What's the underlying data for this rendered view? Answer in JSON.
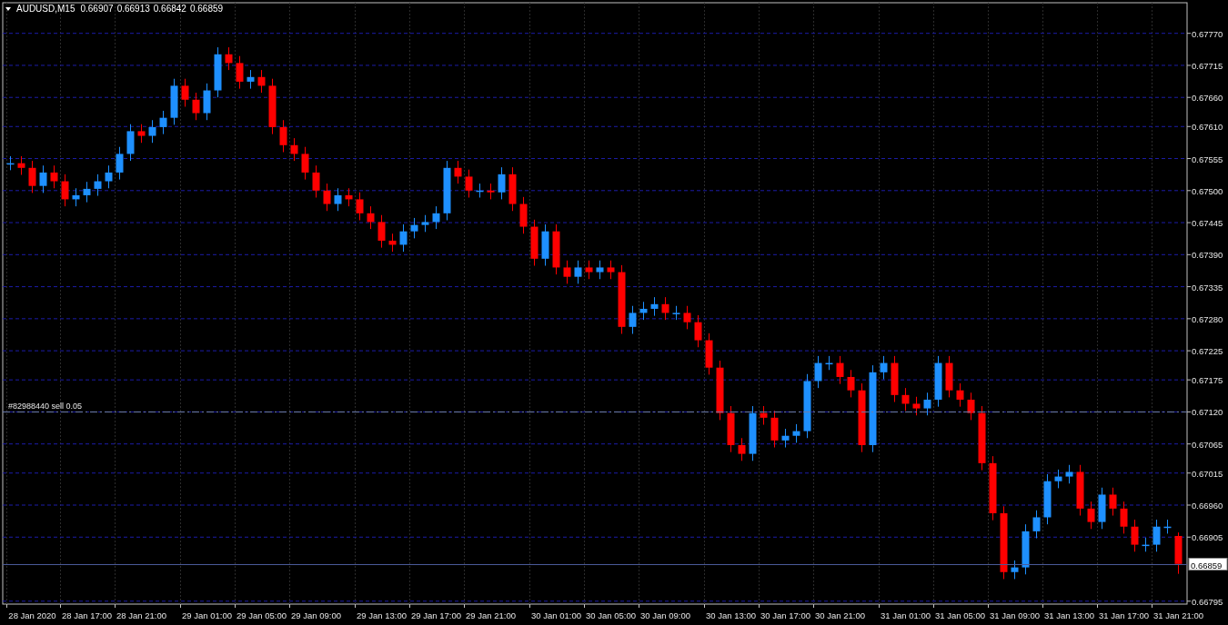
{
  "header": {
    "symbol": "AUDUSD,M15",
    "ohlc": [
      "0.66907",
      "0.66913",
      "0.66842",
      "0.66859"
    ]
  },
  "chart": {
    "chart_data": {
      "type": "candlestick",
      "grid": true,
      "ylim": [
        0.6679,
        0.67821
      ],
      "yticks": [
        {
          "value": 0.6777,
          "label": "0.67770"
        },
        {
          "value": 0.67715,
          "label": "0.67715"
        },
        {
          "value": 0.6766,
          "label": "0.67660"
        },
        {
          "value": 0.6761,
          "label": "0.67610"
        },
        {
          "value": 0.67555,
          "label": "0.67555"
        },
        {
          "value": 0.675,
          "label": "0.67500"
        },
        {
          "value": 0.67445,
          "label": "0.67445"
        },
        {
          "value": 0.6739,
          "label": "0.67390"
        },
        {
          "value": 0.67335,
          "label": "0.67335"
        },
        {
          "value": 0.6728,
          "label": "0.67280"
        },
        {
          "value": 0.67225,
          "label": "0.67225"
        },
        {
          "value": 0.67175,
          "label": "0.67175"
        },
        {
          "value": 0.6712,
          "label": "0.67120"
        },
        {
          "value": 0.67065,
          "label": "0.67065"
        },
        {
          "value": 0.67015,
          "label": "0.67015"
        },
        {
          "value": 0.6696,
          "label": "0.66960"
        },
        {
          "value": 0.66905,
          "label": "0.66905"
        },
        {
          "value": 0.66795,
          "label": "0.66795"
        }
      ],
      "categories": [
        null,
        null,
        "28 Jan 2020",
        null,
        null,
        null,
        null,
        "28 Jan 17:00",
        null,
        null,
        null,
        null,
        "28 Jan 21:00",
        null,
        null,
        null,
        null,
        null,
        "29 Jan 01:00",
        null,
        null,
        null,
        null,
        "29 Jan 05:00",
        null,
        null,
        null,
        null,
        "29 Jan 09:00",
        null,
        null,
        null,
        null,
        null,
        "29 Jan 13:00",
        null,
        null,
        null,
        null,
        "29 Jan 17:00",
        null,
        null,
        null,
        null,
        "29 Jan 21:00",
        null,
        null,
        null,
        null,
        null,
        "30 Jan 01:00",
        null,
        null,
        null,
        null,
        "30 Jan 05:00",
        null,
        null,
        null,
        null,
        "30 Jan 09:00",
        null,
        null,
        null,
        null,
        null,
        "30 Jan 13:00",
        null,
        null,
        null,
        null,
        "30 Jan 17:00",
        null,
        null,
        null,
        null,
        "30 Jan 21:00",
        null,
        null,
        null,
        null,
        null,
        "31 Jan 01:00",
        null,
        null,
        null,
        null,
        "31 Jan 05:00",
        null,
        null,
        null,
        null,
        "31 Jan 09:00",
        null,
        null,
        null,
        null,
        "31 Jan 13:00",
        null,
        null,
        null,
        null,
        "31 Jan 17:00",
        null,
        null,
        null,
        null,
        "31 Jan 21:00"
      ],
      "ohlc": [
        [
          0.67547,
          0.67559,
          0.67535,
          0.67547
        ],
        [
          0.67547,
          0.67559,
          0.67527,
          0.67539
        ],
        [
          0.67539,
          0.67551,
          0.67496,
          0.67508
        ],
        [
          0.67508,
          0.67543,
          0.67496,
          0.67531
        ],
        [
          0.67531,
          0.67543,
          0.67504,
          0.67516
        ],
        [
          0.67516,
          0.67528,
          0.67473,
          0.67485
        ],
        [
          0.67485,
          0.67504,
          0.67473,
          0.67492
        ],
        [
          0.67492,
          0.67515,
          0.6748,
          0.67503
        ],
        [
          0.67503,
          0.67528,
          0.67491,
          0.67516
        ],
        [
          0.67516,
          0.67543,
          0.67504,
          0.67531
        ],
        [
          0.67531,
          0.67575,
          0.67519,
          0.67563
        ],
        [
          0.67563,
          0.67614,
          0.67551,
          0.67602
        ],
        [
          0.67602,
          0.67614,
          0.67582,
          0.67594
        ],
        [
          0.67594,
          0.67621,
          0.67582,
          0.67609
        ],
        [
          0.67609,
          0.67637,
          0.67597,
          0.67625
        ],
        [
          0.67625,
          0.67692,
          0.67613,
          0.6768
        ],
        [
          0.6768,
          0.67692,
          0.67644,
          0.67656
        ],
        [
          0.67656,
          0.67668,
          0.67621,
          0.67633
        ],
        [
          0.67633,
          0.67684,
          0.67621,
          0.67672
        ],
        [
          0.67672,
          0.67746,
          0.6766,
          0.67734
        ],
        [
          0.67734,
          0.67746,
          0.67707,
          0.67719
        ],
        [
          0.67719,
          0.67731,
          0.67675,
          0.67687
        ],
        [
          0.67687,
          0.67707,
          0.67675,
          0.67695
        ],
        [
          0.67695,
          0.67707,
          0.67668,
          0.6768
        ],
        [
          0.6768,
          0.67692,
          0.67597,
          0.67609
        ],
        [
          0.67609,
          0.67621,
          0.67566,
          0.67578
        ],
        [
          0.67578,
          0.6759,
          0.67551,
          0.67563
        ],
        [
          0.67563,
          0.67575,
          0.67519,
          0.67531
        ],
        [
          0.67531,
          0.67543,
          0.67488,
          0.675
        ],
        [
          0.675,
          0.67512,
          0.67465,
          0.67477
        ],
        [
          0.67477,
          0.67504,
          0.67465,
          0.67492
        ],
        [
          0.67492,
          0.67504,
          0.67473,
          0.67485
        ],
        [
          0.67485,
          0.67497,
          0.67449,
          0.67461
        ],
        [
          0.67461,
          0.67473,
          0.67434,
          0.67446
        ],
        [
          0.67446,
          0.67458,
          0.67402,
          0.67414
        ],
        [
          0.67414,
          0.67426,
          0.67395,
          0.67407
        ],
        [
          0.67407,
          0.67442,
          0.67395,
          0.6743
        ],
        [
          0.6743,
          0.67453,
          0.67418,
          0.67441
        ],
        [
          0.67441,
          0.67458,
          0.67429,
          0.67446
        ],
        [
          0.67446,
          0.67473,
          0.67434,
          0.67461
        ],
        [
          0.67461,
          0.67551,
          0.67449,
          0.67539
        ],
        [
          0.67539,
          0.67551,
          0.67512,
          0.67524
        ],
        [
          0.67524,
          0.67536,
          0.67488,
          0.675
        ],
        [
          0.675,
          0.67512,
          0.67488,
          0.675
        ],
        [
          0.675,
          0.67512,
          0.67485,
          0.67497
        ],
        [
          0.67497,
          0.6754,
          0.67485,
          0.67528
        ],
        [
          0.67528,
          0.6754,
          0.67465,
          0.67477
        ],
        [
          0.67477,
          0.67489,
          0.67426,
          0.67438
        ],
        [
          0.67438,
          0.6745,
          0.67371,
          0.67383
        ],
        [
          0.67383,
          0.67442,
          0.67371,
          0.6743
        ],
        [
          0.6743,
          0.67442,
          0.67356,
          0.67368
        ],
        [
          0.67368,
          0.6738,
          0.6734,
          0.67352
        ],
        [
          0.67352,
          0.6738,
          0.6734,
          0.67368
        ],
        [
          0.67368,
          0.6738,
          0.67348,
          0.6736
        ],
        [
          0.6736,
          0.6738,
          0.67348,
          0.67368
        ],
        [
          0.67368,
          0.6738,
          0.67348,
          0.6736
        ],
        [
          0.6736,
          0.67372,
          0.67254,
          0.67266
        ],
        [
          0.67266,
          0.67302,
          0.67254,
          0.6729
        ],
        [
          0.6729,
          0.67309,
          0.67278,
          0.67297
        ],
        [
          0.67297,
          0.67317,
          0.67285,
          0.67305
        ],
        [
          0.67305,
          0.67317,
          0.67278,
          0.6729
        ],
        [
          0.6729,
          0.67302,
          0.67278,
          0.6729
        ],
        [
          0.6729,
          0.67302,
          0.67262,
          0.67274
        ],
        [
          0.67274,
          0.67286,
          0.67231,
          0.67243
        ],
        [
          0.67243,
          0.67255,
          0.67184,
          0.67196
        ],
        [
          0.67196,
          0.67208,
          0.67106,
          0.67118
        ],
        [
          0.67118,
          0.6713,
          0.67051,
          0.67063
        ],
        [
          0.67063,
          0.67075,
          0.67036,
          0.67048
        ],
        [
          0.67048,
          0.6713,
          0.67036,
          0.67118
        ],
        [
          0.67118,
          0.6713,
          0.67098,
          0.6711
        ],
        [
          0.6711,
          0.67122,
          0.67059,
          0.67071
        ],
        [
          0.67071,
          0.67091,
          0.67059,
          0.67079
        ],
        [
          0.67079,
          0.67099,
          0.67067,
          0.67087
        ],
        [
          0.67087,
          0.67185,
          0.67075,
          0.67173
        ],
        [
          0.67173,
          0.67216,
          0.67161,
          0.67204
        ],
        [
          0.67204,
          0.67216,
          0.67192,
          0.67204
        ],
        [
          0.67204,
          0.67216,
          0.67168,
          0.6718
        ],
        [
          0.6718,
          0.67192,
          0.67145,
          0.67157
        ],
        [
          0.67157,
          0.67169,
          0.67051,
          0.67063
        ],
        [
          0.67063,
          0.672,
          0.67051,
          0.67188
        ],
        [
          0.67188,
          0.67216,
          0.67176,
          0.67204
        ],
        [
          0.67204,
          0.67216,
          0.67137,
          0.67149
        ],
        [
          0.67149,
          0.67161,
          0.67122,
          0.67134
        ],
        [
          0.67134,
          0.67146,
          0.67114,
          0.67126
        ],
        [
          0.67126,
          0.67153,
          0.67114,
          0.67141
        ],
        [
          0.67141,
          0.67216,
          0.67129,
          0.67204
        ],
        [
          0.67204,
          0.67216,
          0.67145,
          0.67157
        ],
        [
          0.67157,
          0.67169,
          0.67129,
          0.67141
        ],
        [
          0.67141,
          0.67153,
          0.67106,
          0.67118
        ],
        [
          0.67118,
          0.6713,
          0.6702,
          0.67032
        ],
        [
          0.67032,
          0.67044,
          0.66934,
          0.66946
        ],
        [
          0.66946,
          0.66958,
          0.66833,
          0.66845
        ],
        [
          0.66845,
          0.66865,
          0.66833,
          0.66853
        ],
        [
          0.66853,
          0.66927,
          0.66841,
          0.66915
        ],
        [
          0.66915,
          0.66951,
          0.66903,
          0.66939
        ],
        [
          0.66939,
          0.67013,
          0.66927,
          0.67001
        ],
        [
          0.67001,
          0.67021,
          0.66989,
          0.67009
        ],
        [
          0.67009,
          0.67029,
          0.66997,
          0.67017
        ],
        [
          0.67017,
          0.67029,
          0.66942,
          0.66954
        ],
        [
          0.66954,
          0.66966,
          0.66919,
          0.66931
        ],
        [
          0.66931,
          0.6699,
          0.66919,
          0.66978
        ],
        [
          0.66978,
          0.6699,
          0.66942,
          0.66954
        ],
        [
          0.66954,
          0.66966,
          0.66911,
          0.66923
        ],
        [
          0.66923,
          0.66935,
          0.6688,
          0.66892
        ],
        [
          0.66892,
          0.66904,
          0.6688,
          0.66892
        ],
        [
          0.66892,
          0.66935,
          0.6688,
          0.66923
        ],
        [
          0.66923,
          0.66935,
          0.66911,
          0.66923
        ],
        [
          0.66907,
          0.66913,
          0.66842,
          0.66859
        ]
      ],
      "ref_lines": [
        {
          "axis": "y",
          "value": 0.6712,
          "label": "#82988440 sell 0.05"
        },
        {
          "axis": "y",
          "value": 0.66859,
          "label": "0.66859"
        }
      ]
    }
  }
}
